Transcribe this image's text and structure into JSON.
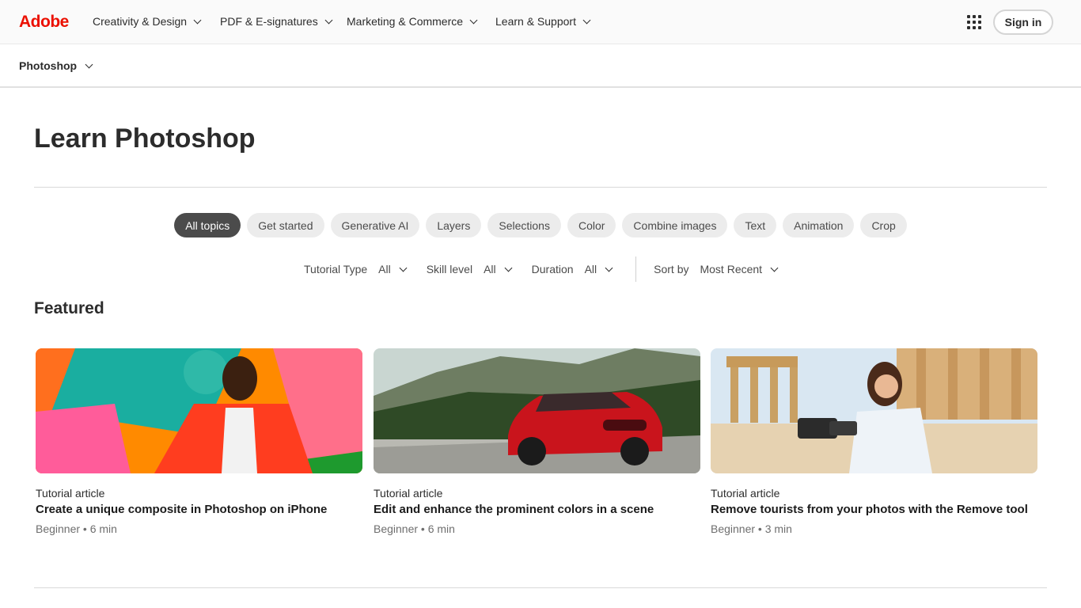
{
  "global_nav": {
    "logo": "Adobe",
    "items": [
      {
        "label": "Creativity & Design"
      },
      {
        "label": "PDF & E-signatures"
      },
      {
        "label": "Marketing & Commerce"
      },
      {
        "label": "Learn & Support"
      }
    ],
    "sign_in": "Sign in",
    "apps_icon": "app-grid-icon"
  },
  "local_nav": {
    "product": "Photoshop"
  },
  "main": {
    "title": "Learn Photoshop",
    "topics": [
      {
        "label": "All topics",
        "active": true
      },
      {
        "label": "Get started"
      },
      {
        "label": "Generative AI"
      },
      {
        "label": "Layers"
      },
      {
        "label": "Selections"
      },
      {
        "label": "Color"
      },
      {
        "label": "Combine images"
      },
      {
        "label": "Text"
      },
      {
        "label": "Animation"
      },
      {
        "label": "Crop"
      }
    ],
    "filters": {
      "tutorial_type": {
        "label": "Tutorial Type",
        "value": "All"
      },
      "skill_level": {
        "label": "Skill level",
        "value": "All"
      },
      "duration": {
        "label": "Duration",
        "value": "All"
      },
      "sort": {
        "label": "Sort by",
        "value": "Most Recent"
      }
    },
    "featured_heading": "Featured",
    "cards": [
      {
        "type": "Tutorial article",
        "title": "Create a unique composite in Photoshop on iPhone",
        "meta": "Beginner • 6 min"
      },
      {
        "type": "Tutorial article",
        "title": "Edit and enhance the prominent colors in a scene",
        "meta": "Beginner • 6 min"
      },
      {
        "type": "Tutorial article",
        "title": "Remove tourists from your photos with the Remove tool",
        "meta": "Beginner • 3 min"
      }
    ]
  },
  "colors": {
    "brand": "#eb1000",
    "chip_active": "#4b4b4b",
    "chip_bg": "#ececec",
    "text": "#2c2c2c"
  }
}
